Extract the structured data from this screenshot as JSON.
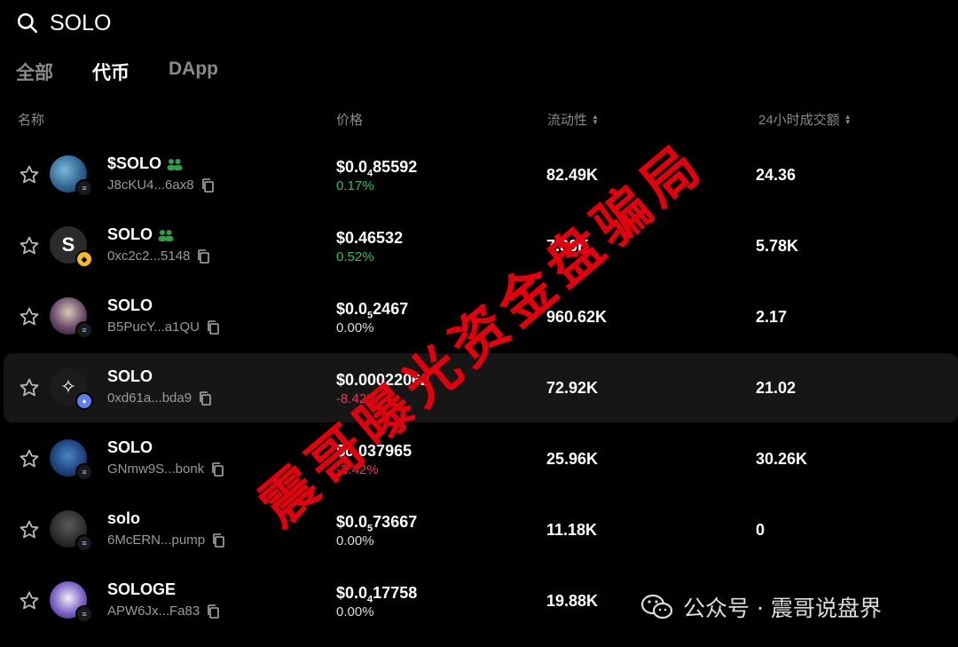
{
  "search": {
    "value": "SOLO"
  },
  "tabs": [
    {
      "label": "全部",
      "active": false
    },
    {
      "label": "代币",
      "active": true
    },
    {
      "label": "DApp",
      "active": false
    }
  ],
  "columns": {
    "name": "名称",
    "price": "价格",
    "liquidity": "流动性",
    "volume": "24小时成交额"
  },
  "rows": [
    {
      "symbol": "$SOLO",
      "community": true,
      "address": "J8cKU4...6ax8",
      "chain": "solana",
      "price_prefix": "$0.0",
      "price_sub": "4",
      "price_rest": "85592",
      "change": "0.17%",
      "change_dir": "pos",
      "liquidity": "82.49K",
      "volume": "24.36"
    },
    {
      "symbol": "SOLO",
      "community": true,
      "address": "0xc2c2...5148",
      "chain": "bnb",
      "price_prefix": "$0.46532",
      "price_sub": "",
      "price_rest": "",
      "change": "0.52%",
      "change_dir": "pos",
      "liquidity": "7.36K",
      "volume": "5.78K"
    },
    {
      "symbol": "SOLO",
      "community": false,
      "address": "B5PucY...a1QU",
      "chain": "solana",
      "price_prefix": "$0.0",
      "price_sub": "5",
      "price_rest": "2467",
      "change": "0.00%",
      "change_dir": "flat",
      "liquidity": "960.62K",
      "volume": "2.17"
    },
    {
      "symbol": "SOLO",
      "community": false,
      "address": "0xd61a...bda9",
      "chain": "ethereum",
      "price_prefix": "$0.00022062",
      "price_sub": "",
      "price_rest": "",
      "change": "-8.42%",
      "change_dir": "neg",
      "liquidity": "72.92K",
      "volume": "21.02"
    },
    {
      "symbol": "SOLO",
      "community": false,
      "address": "GNmw9S...bonk",
      "chain": "solana",
      "price_prefix": "$0.0",
      "price_sub": "",
      "price_rest": "37965",
      "change": "-3.42%",
      "change_dir": "neg",
      "liquidity": "25.96K",
      "volume": "30.26K"
    },
    {
      "symbol": "solo",
      "community": false,
      "address": "6McERN...pump",
      "chain": "solana",
      "price_prefix": "$0.0",
      "price_sub": "5",
      "price_rest": "73667",
      "change": "0.00%",
      "change_dir": "flat",
      "liquidity": "11.18K",
      "volume": "0"
    },
    {
      "symbol": "SOLOGE",
      "community": false,
      "address": "APW6Jx...Fa83",
      "chain": "solana",
      "price_prefix": "$0.0",
      "price_sub": "4",
      "price_rest": "17758",
      "change": "0.00%",
      "change_dir": "flat",
      "liquidity": "19.88K",
      "volume": ""
    }
  ],
  "watermark": {
    "text": "震哥曝光资金盘骗局",
    "color": "#e0000e"
  },
  "footer": {
    "wechat_label": "公众号 · 震哥说盘界"
  },
  "colors": {
    "positive": "#1fc16b",
    "negative": "#e5395f",
    "background": "#000000"
  },
  "icons": {
    "search": "search-icon",
    "star": "star-outline-icon",
    "copy": "copy-icon",
    "community": "people-icon",
    "sort": "sort-arrows-icon"
  }
}
